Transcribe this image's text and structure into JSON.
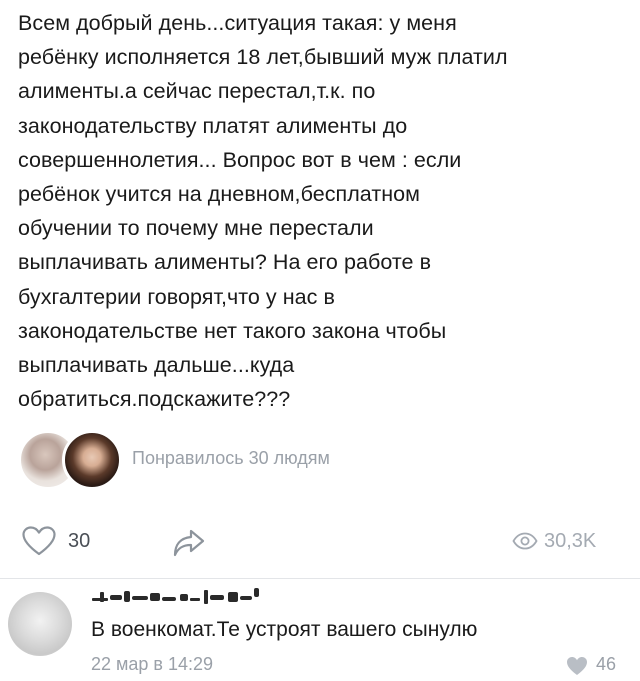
{
  "post": {
    "lines": [
      "Всем добрый день...ситуация такая: у меня",
      "ребёнку исполняется 18 лет,бывший муж платил",
      "алименты.а сейчас перестал,т.к. по",
      "законодательству платят алименты до",
      "совершеннолетия... Вопрос вот в чем : если",
      "ребёнок учится на дневном,бесплатном",
      "обучении то почему мне перестали",
      "выплачивать алименты? На его работе в",
      "бухгалтерии говорят,что у нас в",
      "законодательстве нет такого закона чтобы",
      "выплачивать дальше...куда",
      "обратиться.подскажите???"
    ]
  },
  "likes_summary": {
    "text": "Понравилось 30 людям"
  },
  "actions": {
    "likes_count": "30",
    "views_count": "30,3K"
  },
  "comment": {
    "text": "В военкомат.Те устроят вашего сынулю",
    "time": "22 мар в 14:29",
    "likes": "46"
  },
  "colors": {
    "muted": "#9aa0a8",
    "text": "#1a1a1a"
  }
}
